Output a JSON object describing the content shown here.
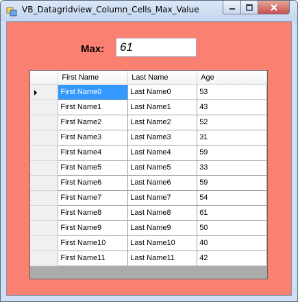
{
  "window": {
    "title": "VB_Datagridview_Column_Cells_Max_Value",
    "icon": "app-window-icon",
    "controls": [
      "minimize-icon",
      "maximize-icon",
      "close-icon"
    ]
  },
  "form": {
    "max_label": "Max:",
    "max_value": "61",
    "background": "#fa8072"
  },
  "grid": {
    "columns": [
      "First Name",
      "Last Name",
      "Age"
    ],
    "current_row": 0,
    "selected_cell": "First Name0",
    "selection_color": "#3399ff",
    "rows": [
      {
        "first": "First Name0",
        "last": "Last Name0",
        "age": "53"
      },
      {
        "first": "First Name1",
        "last": "Last Name1",
        "age": "43"
      },
      {
        "first": "First Name2",
        "last": "Last Name2",
        "age": "52"
      },
      {
        "first": "First Name3",
        "last": "Last Name3",
        "age": "31"
      },
      {
        "first": "First Name4",
        "last": "Last Name4",
        "age": "59"
      },
      {
        "first": "First Name5",
        "last": "Last Name5",
        "age": "33"
      },
      {
        "first": "First Name6",
        "last": "Last Name6",
        "age": "59"
      },
      {
        "first": "First Name7",
        "last": "Last Name7",
        "age": "54"
      },
      {
        "first": "First Name8",
        "last": "Last Name8",
        "age": "61"
      },
      {
        "first": "First Name9",
        "last": "Last Name9",
        "age": "50"
      },
      {
        "first": "First Name10",
        "last": "Last Name10",
        "age": "40"
      },
      {
        "first": "First Name11",
        "last": "Last Name11",
        "age": "42"
      }
    ]
  }
}
